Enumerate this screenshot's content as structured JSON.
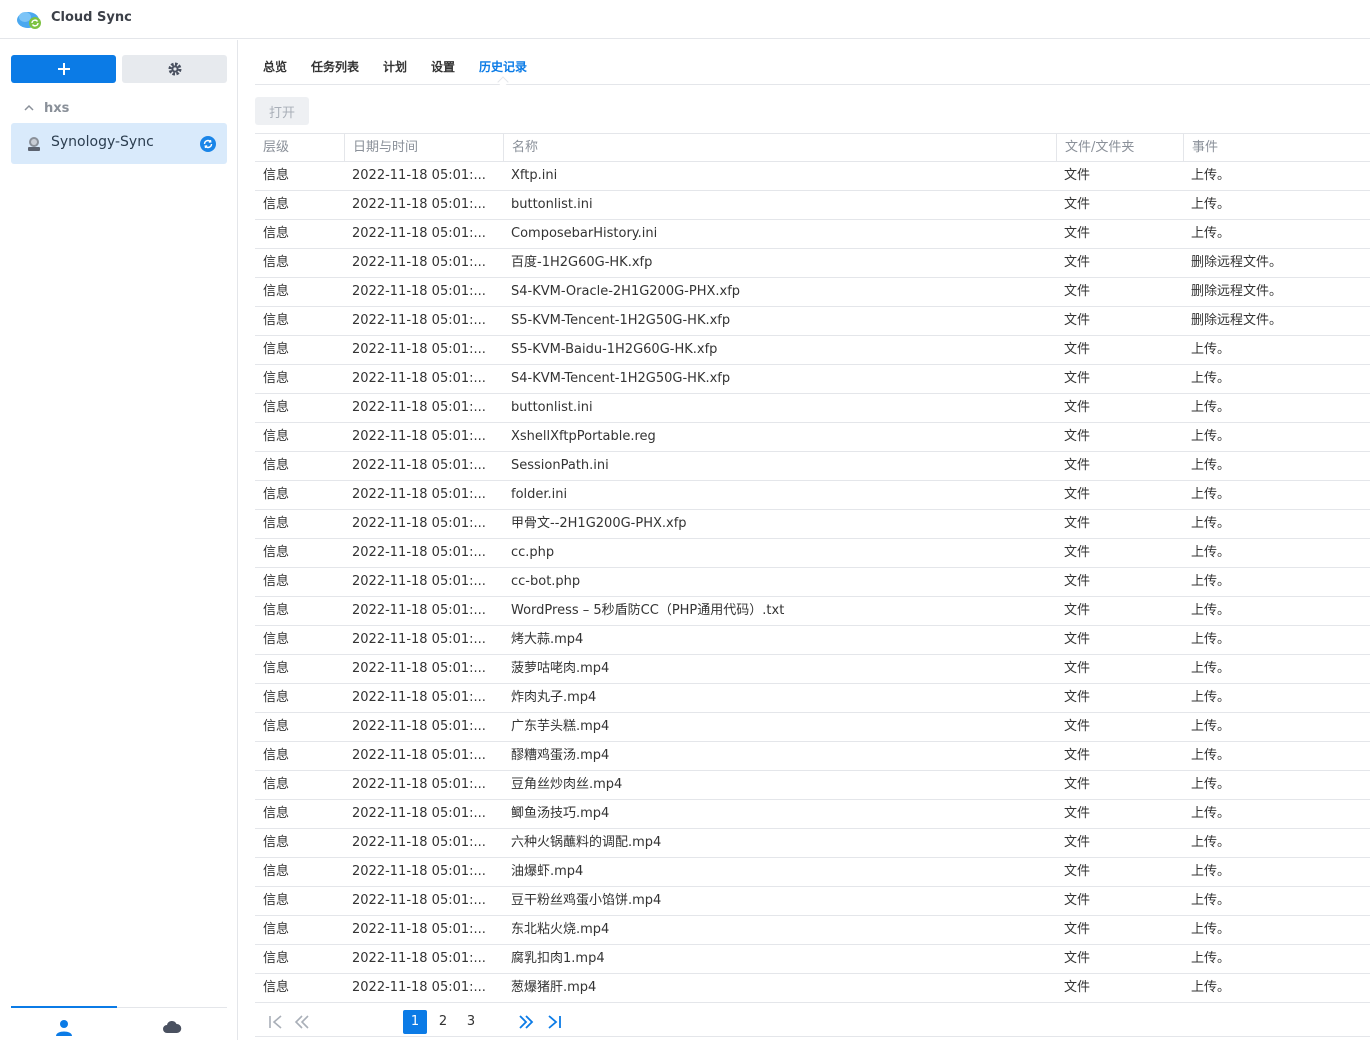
{
  "app": {
    "title": "Cloud Sync"
  },
  "sidebar": {
    "group": "hxs",
    "tasks": [
      {
        "label": "Synology-Sync"
      }
    ]
  },
  "tabs": [
    {
      "label": "总览"
    },
    {
      "label": "任务列表"
    },
    {
      "label": "计划"
    },
    {
      "label": "设置"
    },
    {
      "label": "历史记录",
      "active": true
    }
  ],
  "toolbar": {
    "open_label": "打开"
  },
  "table": {
    "columns": [
      "层级",
      "日期与时间",
      "名称",
      "文件/文件夹",
      "事件"
    ],
    "rows": [
      [
        "信息",
        "2022-11-18 05:01:...",
        "Xftp.ini",
        "文件",
        "上传。"
      ],
      [
        "信息",
        "2022-11-18 05:01:...",
        "buttonlist.ini",
        "文件",
        "上传。"
      ],
      [
        "信息",
        "2022-11-18 05:01:...",
        "ComposebarHistory.ini",
        "文件",
        "上传。"
      ],
      [
        "信息",
        "2022-11-18 05:01:...",
        "百度-1H2G60G-HK.xfp",
        "文件",
        "删除远程文件。"
      ],
      [
        "信息",
        "2022-11-18 05:01:...",
        "S4-KVM-Oracle-2H1G200G-PHX.xfp",
        "文件",
        "删除远程文件。"
      ],
      [
        "信息",
        "2022-11-18 05:01:...",
        "S5-KVM-Tencent-1H2G50G-HK.xfp",
        "文件",
        "删除远程文件。"
      ],
      [
        "信息",
        "2022-11-18 05:01:...",
        "S5-KVM-Baidu-1H2G60G-HK.xfp",
        "文件",
        "上传。"
      ],
      [
        "信息",
        "2022-11-18 05:01:...",
        "S4-KVM-Tencent-1H2G50G-HK.xfp",
        "文件",
        "上传。"
      ],
      [
        "信息",
        "2022-11-18 05:01:...",
        "buttonlist.ini",
        "文件",
        "上传。"
      ],
      [
        "信息",
        "2022-11-18 05:01:...",
        "XshellXftpPortable.reg",
        "文件",
        "上传。"
      ],
      [
        "信息",
        "2022-11-18 05:01:...",
        "SessionPath.ini",
        "文件",
        "上传。"
      ],
      [
        "信息",
        "2022-11-18 05:01:...",
        "folder.ini",
        "文件",
        "上传。"
      ],
      [
        "信息",
        "2022-11-18 05:01:...",
        "甲骨文--2H1G200G-PHX.xfp",
        "文件",
        "上传。"
      ],
      [
        "信息",
        "2022-11-18 05:01:...",
        "cc.php",
        "文件",
        "上传。"
      ],
      [
        "信息",
        "2022-11-18 05:01:...",
        "cc-bot.php",
        "文件",
        "上传。"
      ],
      [
        "信息",
        "2022-11-18 05:01:...",
        "WordPress – 5秒盾防CC（PHP通用代码）.txt",
        "文件",
        "上传。"
      ],
      [
        "信息",
        "2022-11-18 05:01:...",
        "烤大蒜.mp4",
        "文件",
        "上传。"
      ],
      [
        "信息",
        "2022-11-18 05:01:...",
        "菠萝咕咾肉.mp4",
        "文件",
        "上传。"
      ],
      [
        "信息",
        "2022-11-18 05:01:...",
        "炸肉丸子.mp4",
        "文件",
        "上传。"
      ],
      [
        "信息",
        "2022-11-18 05:01:...",
        "广东芋头糕.mp4",
        "文件",
        "上传。"
      ],
      [
        "信息",
        "2022-11-18 05:01:...",
        "醪糟鸡蛋汤.mp4",
        "文件",
        "上传。"
      ],
      [
        "信息",
        "2022-11-18 05:01:...",
        "豆角丝炒肉丝.mp4",
        "文件",
        "上传。"
      ],
      [
        "信息",
        "2022-11-18 05:01:...",
        "鲫鱼汤技巧.mp4",
        "文件",
        "上传。"
      ],
      [
        "信息",
        "2022-11-18 05:01:...",
        "六种火锅蘸料的调配.mp4",
        "文件",
        "上传。"
      ],
      [
        "信息",
        "2022-11-18 05:01:...",
        "油爆虾.mp4",
        "文件",
        "上传。"
      ],
      [
        "信息",
        "2022-11-18 05:01:...",
        "豆干粉丝鸡蛋小馅饼.mp4",
        "文件",
        "上传。"
      ],
      [
        "信息",
        "2022-11-18 05:01:...",
        "东北粘火烧.mp4",
        "文件",
        "上传。"
      ],
      [
        "信息",
        "2022-11-18 05:01:...",
        "腐乳扣肉1.mp4",
        "文件",
        "上传。"
      ],
      [
        "信息",
        "2022-11-18 05:01:...",
        "葱爆猪肝.mp4",
        "文件",
        "上传。"
      ]
    ]
  },
  "pagination": {
    "pages": [
      "1",
      "2",
      "3"
    ],
    "current": "1"
  },
  "colors": {
    "accent": "#0b7be6",
    "selected_bg": "#d9eafb"
  }
}
